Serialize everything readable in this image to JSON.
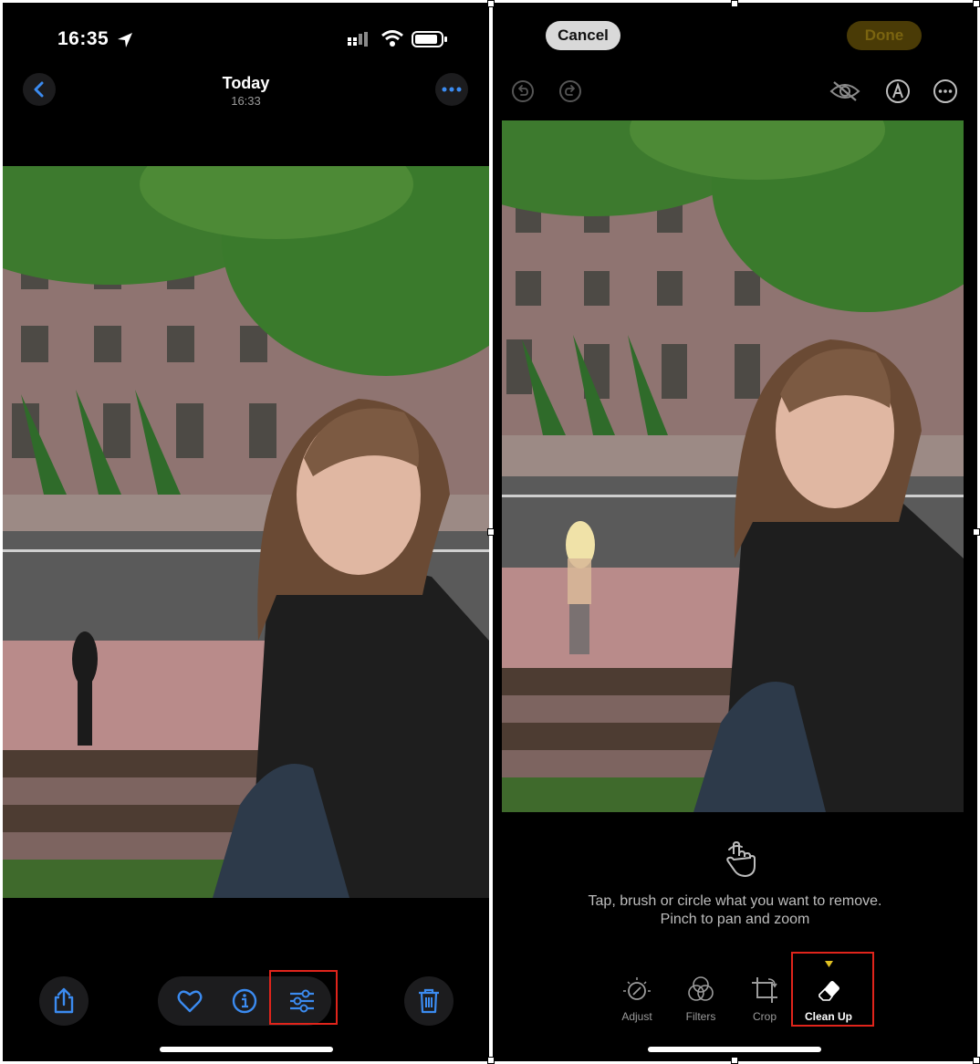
{
  "left": {
    "status": {
      "time": "16:35"
    },
    "nav": {
      "title": "Today",
      "subtitle": "16:33"
    },
    "icons": {
      "back": "chevron-left-icon",
      "more": "ellipsis-icon",
      "share": "share-icon",
      "favorite": "heart-icon",
      "info": "info-icon",
      "edit": "sliders-icon",
      "delete": "trash-icon"
    }
  },
  "right": {
    "top": {
      "cancel_label": "Cancel",
      "done_label": "Done"
    },
    "hint": {
      "line1": "Tap, brush or circle what you want to remove.",
      "line2": "Pinch to pan and zoom"
    },
    "tools": [
      {
        "label": "Adjust",
        "icon": "adjust-dial-icon"
      },
      {
        "label": "Filters",
        "icon": "filters-circles-icon"
      },
      {
        "label": "Crop",
        "icon": "crop-icon"
      },
      {
        "label": "Clean Up",
        "icon": "eraser-icon"
      }
    ]
  },
  "colors": {
    "accent": "#3b8bf0",
    "highlight": "#e0241b",
    "done_bg": "#4a3b06",
    "done_text": "#7a6410",
    "cancel_bg": "#d9d9d9"
  }
}
